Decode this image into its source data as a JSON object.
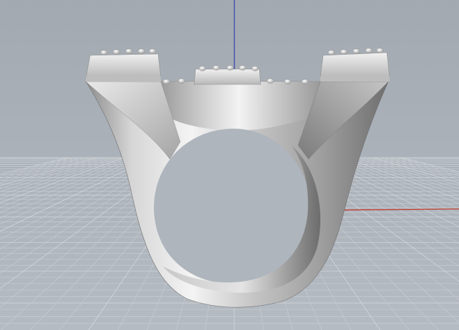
{
  "viewport": {
    "view": "Perspective",
    "background_top": "#a3aab2",
    "background_bottom": "#b4bac1",
    "grid_color": "#c7ccd1",
    "grid_major_color": "#d7dbdf",
    "axes": {
      "x_color": "#c0392b",
      "y_color": "#2e9e3a",
      "z_color": "#2f3fa8"
    }
  },
  "model": {
    "name": "ring",
    "material_color": "#d9d9d9",
    "shadow_color": "#7d7d7d"
  }
}
